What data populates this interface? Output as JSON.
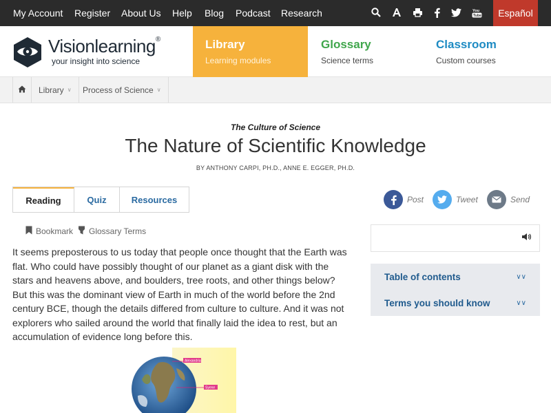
{
  "topnav": {
    "links": [
      "My Account",
      "Register",
      "About Us",
      "Help",
      "Blog",
      "Podcast",
      "Research"
    ],
    "icons": [
      "search-icon",
      "font-size-icon",
      "print-icon",
      "facebook-icon",
      "twitter-icon",
      "youtube-icon"
    ],
    "language_button": "Español"
  },
  "brand": {
    "name": "Visionlearning",
    "registered": "®",
    "tagline": "your insight into science"
  },
  "modules": [
    {
      "title": "Library",
      "subtitle": "Learning modules"
    },
    {
      "title": "Glossary",
      "subtitle": "Science terms"
    },
    {
      "title": "Classroom",
      "subtitle": "Custom courses"
    }
  ],
  "breadcrumb": {
    "home_icon": "home-icon",
    "items": [
      "Library",
      "Process of Science"
    ]
  },
  "article": {
    "series": "The Culture of Science",
    "title": "The Nature of Scientific Knowledge",
    "byline": "BY ANTHONY CARPI, PH.D., ANNE E. EGGER, PH.D.",
    "tabs": [
      "Reading",
      "Quiz",
      "Resources"
    ],
    "tools": {
      "bookmark": "Bookmark",
      "glossary": "Glossary Terms"
    },
    "body": "It seems preposterous to us today that people once thought that the Earth was flat. Who could have possibly thought of our planet as a giant disk with the stars and heavens above, and boulders, tree roots, and other things below? But this was the dominant view of Earth in much of the world before the 2nd century BCE, though the details differed from culture to culture. And it was not explorers who sailed around the world that finally laid the idea to rest, but an accumulation of evidence long before this.",
    "figure_labels": [
      "Alexandria",
      "Syene"
    ]
  },
  "share": [
    {
      "label": "Post",
      "icon": "facebook-icon",
      "color": "#3b5998"
    },
    {
      "label": "Tweet",
      "icon": "twitter-icon",
      "color": "#55acee"
    },
    {
      "label": "Send",
      "icon": "email-icon",
      "color": "#6d7a88"
    }
  ],
  "sidebar": {
    "audio_icon": "speaker-icon",
    "panels": [
      "Table of contents",
      "Terms you should know"
    ]
  },
  "colors": {
    "topbar": "#2b2b2b",
    "espanol": "#c0392b",
    "library": "#f6b23c",
    "glossary": "#3fa64b",
    "classroom": "#1e8bc3",
    "panel_bg": "#e8eaee",
    "link": "#2a6aa1"
  }
}
